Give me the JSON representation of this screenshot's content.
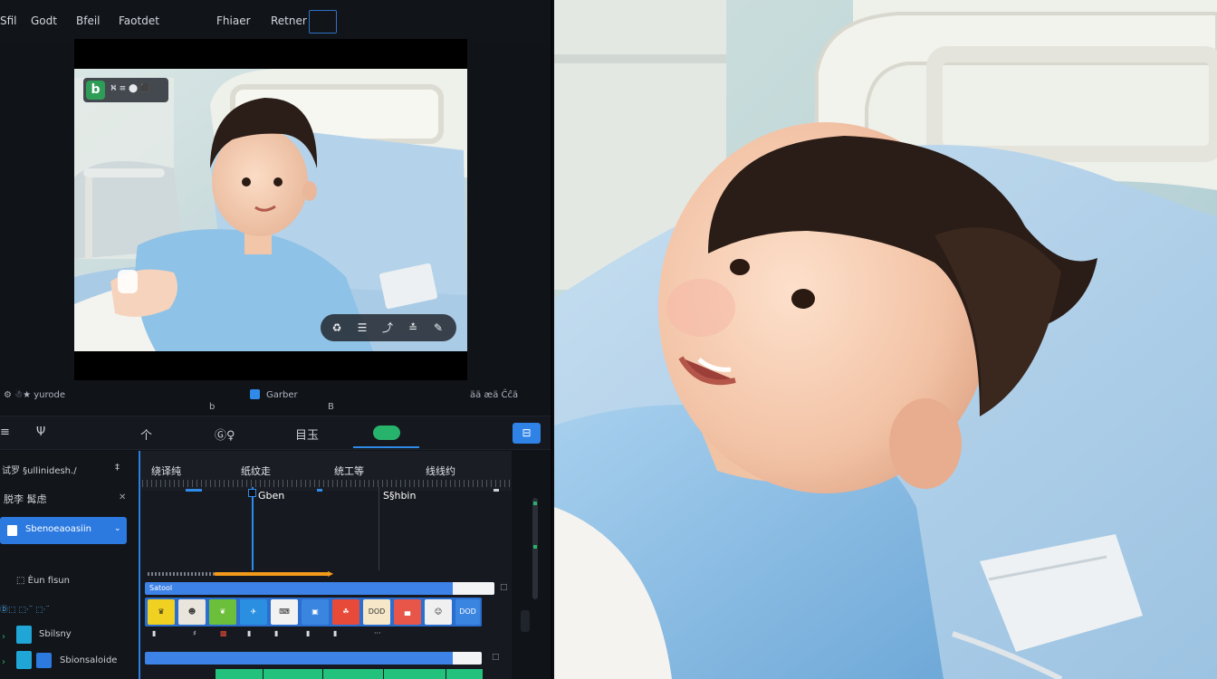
{
  "menu": {
    "items": [
      "Sfil",
      "Godt",
      "Bfeil",
      "Faotdet",
      "Fhiaer",
      "Retner"
    ]
  },
  "preview": {
    "badge_text": "⛕ ≡ ⬤ ⬛"
  },
  "status": {
    "left": "⚙ ☃★  yurode",
    "center_top": "Garber",
    "center_bottom_a": "b",
    "center_bottom_b": "B",
    "right": "ää  æä Ĉĉä"
  },
  "toolbar": {
    "menu_icon": "≡",
    "tool_a": "Ψ",
    "tool_b": "个",
    "tool_c": "Ⓖ♀",
    "tool_d": "目玉",
    "active_tool": "►",
    "right_button": "⊟"
  },
  "side_panel": {
    "header": "试罗 §ullinidesh./",
    "header_icon": "‡",
    "row1": "脱李  髯虑",
    "row1_close": "✕",
    "selected": "Sbenoeaoasiin",
    "section": "⬚  Èun fisun",
    "row3": "Ⓓ⬚  ⬚·¨  ⬚·¨",
    "row4": "Sbilsny",
    "row5": "Sbionsaloide"
  },
  "timeline": {
    "ruler": [
      "绕译纯",
      "纸纹走",
      "统工等",
      "线线约"
    ],
    "playhead_label": "Gben",
    "marker_label": "S§hbin",
    "track1_label": "Satool",
    "thumbs": [
      "♛",
      "☻",
      "❦",
      "✈",
      "⌨",
      "▣",
      "☘",
      "DOD",
      "▄",
      "☺",
      "DOD"
    ]
  }
}
